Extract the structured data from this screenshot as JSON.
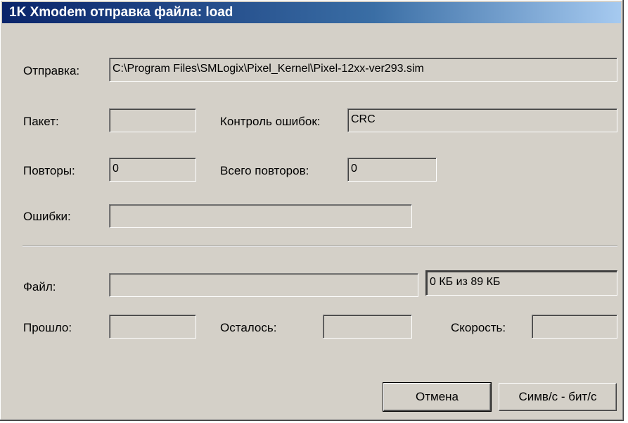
{
  "window": {
    "title": "1K Xmodem отправка файла: load"
  },
  "labels": {
    "sending": "Отправка:",
    "packet": "Пакет:",
    "error_control": "Контроль ошибок:",
    "retries": "Повторы:",
    "total_retries": "Всего повторов:",
    "errors": "Ошибки:",
    "file": "Файл:",
    "elapsed": "Прошло:",
    "remaining": "Осталось:",
    "speed": "Скорость:"
  },
  "values": {
    "sending_path": "C:\\Program Files\\SMLogix\\Pixel_Kernel\\Pixel-12xx-ver293.sim",
    "packet": "",
    "error_control": "CRC",
    "retries": "0",
    "total_retries": "0",
    "errors": "",
    "file_progress_fraction": 0,
    "file_size_text": "0 КБ из 89 КБ",
    "elapsed": "",
    "remaining": "",
    "speed": ""
  },
  "buttons": {
    "cancel": "Отмена",
    "units_toggle": "Симв/с - бит/с"
  }
}
